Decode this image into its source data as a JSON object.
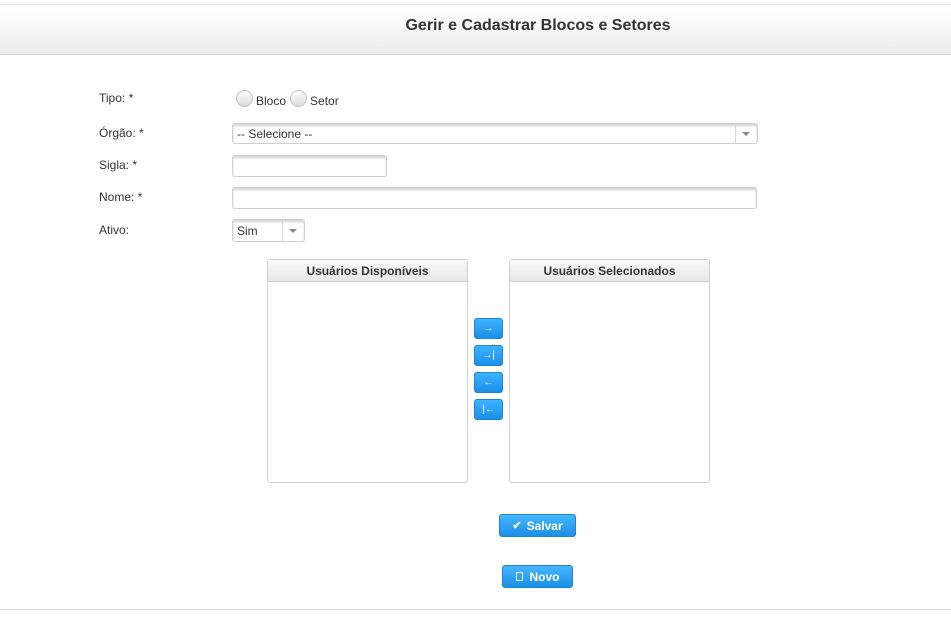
{
  "header": {
    "title": "Gerir e Cadastrar Blocos e Setores"
  },
  "form": {
    "tipo": {
      "label": "Tipo: *",
      "options": [
        "Bloco",
        "Setor"
      ]
    },
    "orgao": {
      "label": "Órgão: *",
      "value": "-- Selecione --"
    },
    "sigla": {
      "label": "Sigla: *",
      "value": ""
    },
    "nome": {
      "label": "Nome: *",
      "value": ""
    },
    "ativo": {
      "label": "Ativo:",
      "value": "Sim"
    }
  },
  "users": {
    "available_title": "Usuários Disponíveis",
    "selected_title": "Usuários Selecionados",
    "move_buttons": {
      "move_right": "→",
      "move_all_right": "→|",
      "move_left": "←",
      "move_all_left": "|←"
    }
  },
  "actions": {
    "save_label": "Salvar",
    "new_label": "Novo"
  }
}
